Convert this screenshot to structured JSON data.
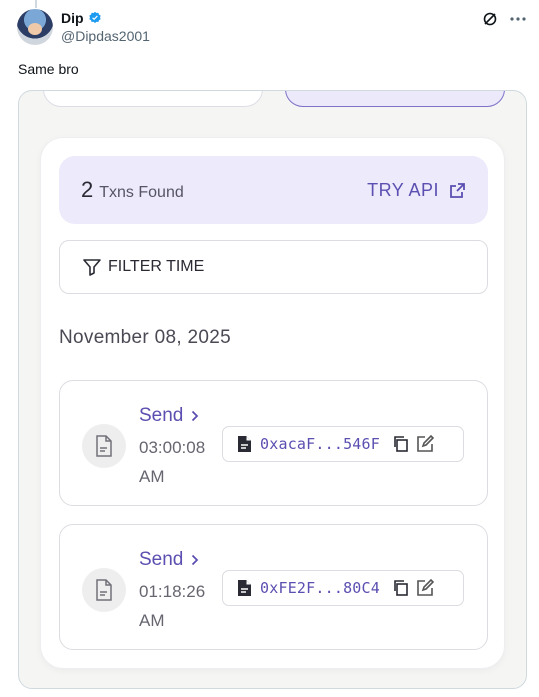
{
  "tweet": {
    "author_name": "Dip",
    "author_handle": "@Dipdas2001",
    "text": "Same bro"
  },
  "icons": {
    "verified": "verified-badge-icon",
    "grok": "grok-icon",
    "more": "more-options-icon"
  },
  "colors": {
    "accent": "#5b4fb1",
    "accent_bg": "#eceafb",
    "verified": "#1d9bf0"
  },
  "explorer": {
    "txn_count": "2",
    "txn_found_label": "Txns Found",
    "try_api_label": "TRY API",
    "filter_label": "FILTER TIME",
    "date_heading": "November 08, 2025",
    "transactions": [
      {
        "type": "Send",
        "time": "03:00:08 AM",
        "hash": "0xacaF...546F"
      },
      {
        "type": "Send",
        "time": "01:18:26 AM",
        "hash": "0xFE2F...80C4"
      }
    ]
  }
}
